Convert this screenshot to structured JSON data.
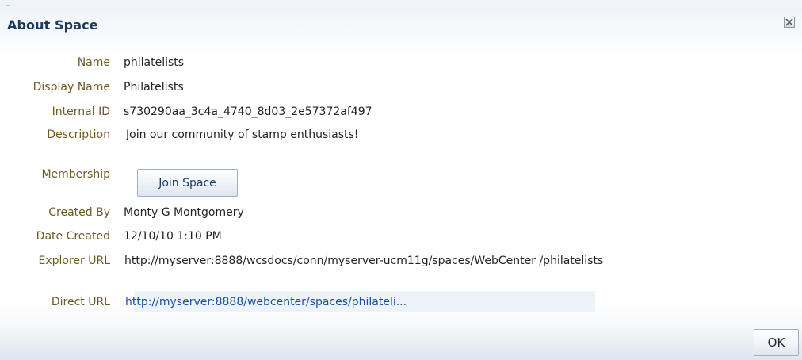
{
  "dialog": {
    "title": "About Space",
    "close_icon": "close-x-icon",
    "ok_label": "OK"
  },
  "fields": {
    "name": {
      "label": "Name",
      "value": "philatelists"
    },
    "display_name": {
      "label": "Display Name",
      "value": "Philatelists"
    },
    "internal_id": {
      "label": "Internal ID",
      "value": "s730290aa_3c4a_4740_8d03_2e57372af497"
    },
    "description": {
      "label": "Description",
      "value": "Join our community of stamp enthusiasts!"
    },
    "membership": {
      "label": "Membership",
      "button_label": "Join Space"
    },
    "created_by": {
      "label": "Created By",
      "value": "Monty G Montgomery"
    },
    "date_created": {
      "label": "Date Created",
      "value": "12/10/10 1:10 PM"
    },
    "explorer_url": {
      "label": "Explorer URL",
      "value": "http://myserver:8888/wcsdocs/conn/myserver-ucm11g/spaces/WebCenter /philatelists"
    },
    "direct_url": {
      "label": "Direct URL",
      "value": "http://myserver:8888/webcenter/spaces/philateli..."
    }
  },
  "colors": {
    "title": "#1e3a5f",
    "label": "#6b5a24",
    "link": "#1b4ea1"
  }
}
